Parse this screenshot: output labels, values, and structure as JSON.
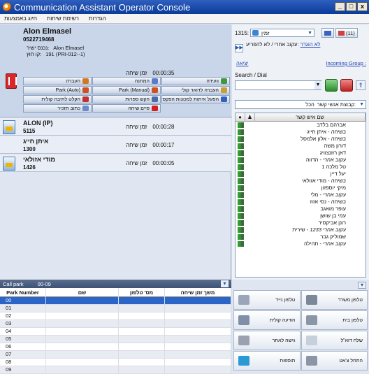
{
  "window": {
    "title": "Communication Assistant Operator Console",
    "minimize": "_",
    "maximize": "□",
    "close": "x"
  },
  "menu": [
    "הגדרות",
    "רשימת שיחות",
    "חיוג באמצעות"
  ],
  "active_call": {
    "name": "Alon Elmasel",
    "number": "0522719468",
    "incoming_label": "נכנס ישיר:",
    "incoming_value": "Alon Elmasel",
    "line_label": "קו חוץ:",
    "line_value": "191 (PRI-012--1)",
    "time_label": "זמן שיחה",
    "time_value": "00:00:35",
    "buttons": [
      {
        "label": "וועידה",
        "icon_color": "#3c9a3c"
      },
      {
        "label": "המתנה",
        "icon_color": "#5a7cc8"
      },
      {
        "label": "העברה",
        "icon_color": "#d07a20"
      },
      {
        "label": "העברה לדואר קולי",
        "icon_color": "#c8a030"
      },
      {
        "label": "Park (Manual)",
        "icon_color": "#d05020"
      },
      {
        "label": "Park (Auto)",
        "icon_color": "#d05020"
      },
      {
        "label": "הפעל איתות למכונות הפקס",
        "icon_color": "#3060c0"
      },
      {
        "label": "הקש ספרות",
        "icon_color": "#4a6aa8"
      },
      {
        "label": "הקלט לתיבה קולית",
        "icon_color": "#c03030"
      },
      {
        "label": "",
        "icon_color": ""
      },
      {
        "label": "סיים שיחה",
        "icon_color": "#d02020"
      },
      {
        "label": "כתוב תזכיר",
        "icon_color": "#6a8ac8"
      }
    ]
  },
  "calls": [
    {
      "name": "ALON (IP)",
      "number": "5115",
      "time_label": "זמן שיחה",
      "time": "00:00:28"
    },
    {
      "name": "איתן חייג",
      "number": "1300",
      "time_label": "זמן שיחה",
      "time": "00:00:17"
    },
    {
      "name": "מודי אזולאי",
      "number": "1426",
      "time_label": "זמן שיחה",
      "time": "00:00:05"
    }
  ],
  "park": {
    "title": "Call park",
    "range": "00-09",
    "columns": [
      "Park Number",
      "שם",
      "מס' טלפון",
      "משך זמן שיחה"
    ],
    "rows": [
      "00",
      "01",
      "02",
      "03",
      "04",
      "05",
      "06",
      "07",
      "08",
      "09"
    ]
  },
  "right": {
    "extension": "1315:",
    "status": "זמין",
    "count_button": "(11)",
    "not_available_link": "לא הוגדר",
    "forward_text": ":עקוב אחרי / לא להפריע",
    "incoming_group": "Incoming Group :",
    "exit_link": "יציאה",
    "search_label": "Search / Dial",
    "search_value": "",
    "group_select_value": "הכל",
    "group_select_label": "קבוצת אנשי קשר:",
    "contacts_header": "שם איש קשר",
    "contacts": [
      {
        "state": "",
        "name": "אברהם בלדב"
      },
      {
        "state": "בשיחה",
        "name": "איתן חייג"
      },
      {
        "state": "בשיחה",
        "name": "אלון אלמסל"
      },
      {
        "state": "",
        "name": "דורון משה"
      },
      {
        "state": "",
        "name": "דאן רוזנצוויג"
      },
      {
        "state": "עקוב אחרי",
        "name": "הדווה"
      },
      {
        "state": "",
        "name": "טל מלכה 1"
      },
      {
        "state": "",
        "name": "יעל דיין"
      },
      {
        "state": "בשיחה",
        "name": "מודי אזולאי"
      },
      {
        "state": "",
        "name": "מיקי יוספזון"
      },
      {
        "state": "עקוב אחרי",
        "name": "מלי"
      },
      {
        "state": "בשיחה",
        "name": "נסי אזוז"
      },
      {
        "state": "",
        "name": "עופר מואגב"
      },
      {
        "state": "",
        "name": "עמי בן שושן"
      },
      {
        "state": "",
        "name": "רונן אביקסיר"
      },
      {
        "state": "עקוב אחרי 1233",
        "name": "שירית"
      },
      {
        "state": "",
        "name": "שמוליק גבר"
      },
      {
        "state": "עקוב אחרי",
        "name": "תהילה"
      }
    ]
  },
  "quick_buttons": [
    {
      "label": "טלפון נייד",
      "name": "mobile-phone-button",
      "icon_color": "#9aa6b8"
    },
    {
      "label": "טלפון משרד",
      "name": "office-phone-button",
      "icon_color": "#7a8898"
    },
    {
      "label": "הודעה קולית",
      "name": "voice-message-button",
      "icon_color": "#7f8fa8"
    },
    {
      "label": "טלפון בית",
      "name": "home-phone-button",
      "icon_color": "#8a96a6"
    },
    {
      "label": "גישה לאתר",
      "name": "website-access-button",
      "icon_color": "#9aa2b2"
    },
    {
      "label": "שלח דוא\"ל",
      "name": "send-email-button",
      "icon_color": "#c7cfdb"
    },
    {
      "label": "תוספות",
      "name": "addons-button",
      "icon_color": "#2a9ad4"
    },
    {
      "label": "התחל צ'אט",
      "name": "start-chat-button",
      "icon_color": "#8a96a6"
    }
  ]
}
